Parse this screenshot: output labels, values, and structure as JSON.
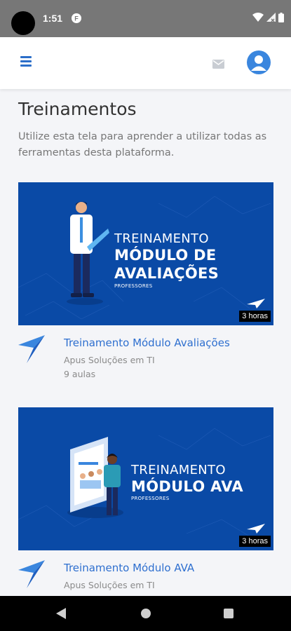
{
  "status_bar": {
    "time": "1:51",
    "icons": [
      "camera-cutout",
      "app-notification-icon",
      "wifi-icon",
      "signal-icon",
      "battery-icon"
    ]
  },
  "header": {
    "icons": [
      "menu-icon",
      "mail-icon",
      "user-avatar-icon"
    ],
    "accent_color": "#2b6ec9"
  },
  "page": {
    "title": "Treinamentos",
    "subtitle": "Utilize esta tela para aprender a utilizar todas as ferramentas desta plataforma."
  },
  "courses": [
    {
      "banner_line1": "TREINAMENTO",
      "banner_line2": "MÓDULO DE",
      "banner_line3": "AVALIAÇÕES",
      "banner_audience": "PROFESSORES",
      "duration": "3 horas",
      "title": "Treinamento Módulo Avaliações",
      "author": "Apus Soluções em TI",
      "lessons": "9 aulas"
    },
    {
      "banner_line1": "TREINAMENTO",
      "banner_line2": "MÓDULO AVA",
      "banner_audience": "PROFESSORES",
      "duration": "3 horas",
      "title": "Treinamento Módulo AVA",
      "author": "Apus Soluções em TI"
    }
  ],
  "colors": {
    "banner_blue": "#0a4aa6",
    "link_blue": "#2e6fcf",
    "status_bar": "#777777"
  },
  "nav_bar": {
    "icons": [
      "back-icon",
      "home-icon",
      "recents-icon"
    ]
  }
}
